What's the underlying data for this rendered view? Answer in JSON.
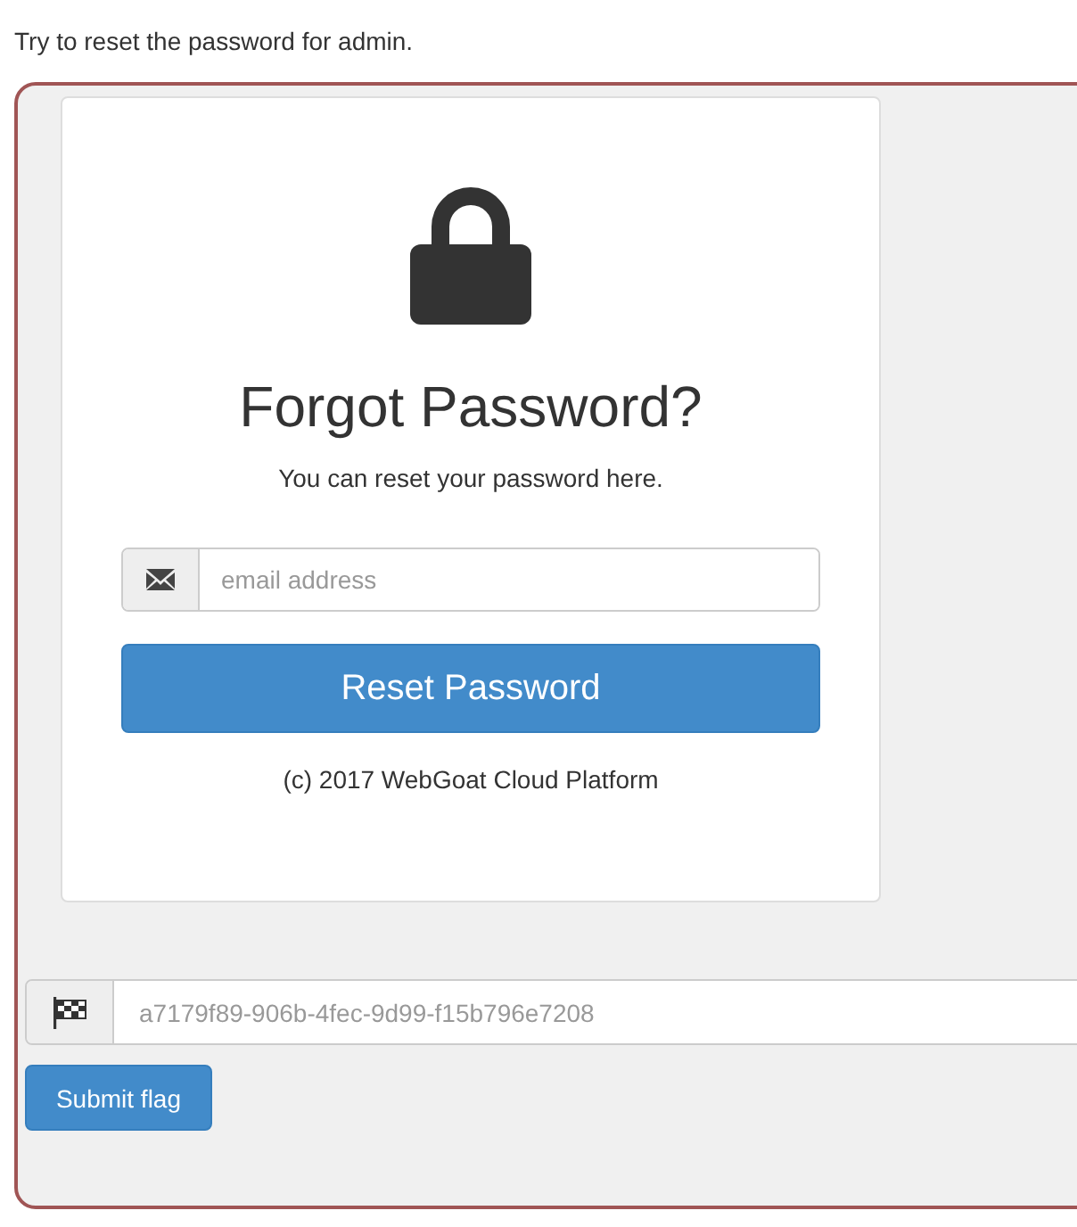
{
  "instruction": "Try to reset the password for admin.",
  "card": {
    "title": "Forgot Password?",
    "subtitle": "You can reset your password here.",
    "email": {
      "placeholder": "email address"
    },
    "button": "Reset Password",
    "footer": "(c) 2017 WebGoat Cloud Platform"
  },
  "flag": {
    "placeholder": "a7179f89-906b-4fec-9d99-f15b796e7208",
    "button": "Submit flag"
  }
}
